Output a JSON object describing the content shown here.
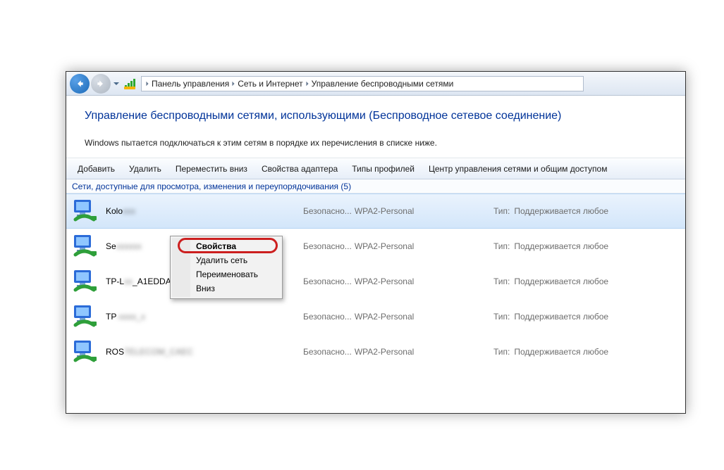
{
  "breadcrumb": {
    "item1": "Панель управления",
    "item2": "Сеть и Интернет",
    "item3": "Управление беспроводными сетями"
  },
  "header": {
    "title": "Управление беспроводными сетями, использующими (Беспроводное сетевое соединение)",
    "description": "Windows пытается подключаться к этим сетям в порядке их перечисления в списке ниже."
  },
  "toolbar": {
    "add": "Добавить",
    "remove": "Удалить",
    "move_down": "Переместить вниз",
    "adapter_props": "Свойства адаптера",
    "profile_types": "Типы профилей",
    "network_center": "Центр управления сетями и общим доступом"
  },
  "group_header": "Сети, доступные для просмотра, изменения и переупорядочивания (5)",
  "columns": {
    "security_label": "Безопасно...",
    "type_label": "Тип:"
  },
  "networks": [
    {
      "name_prefix": "Kolo",
      "name_blur": "xxx",
      "security": "WPA2-Personal",
      "type": "Поддерживается любое",
      "selected": true
    },
    {
      "name_prefix": "Se",
      "name_blur": "xxxxxx",
      "security": "WPA2-Personal",
      "type": "Поддерживается любое",
      "selected": false
    },
    {
      "name_prefix": "TP-L",
      "name_mid": "_A1EDDA",
      "name_blur": "xx",
      "security": "WPA2-Personal",
      "type": "Поддерживается любое",
      "selected": false
    },
    {
      "name_prefix": "TP",
      "name_blur": "-xxxx_x",
      "security": "WPA2-Personal",
      "type": "Поддерживается любое",
      "selected": false
    },
    {
      "name_prefix": "ROS",
      "name_blur": "TELECOM_CAEC",
      "security": "WPA2-Personal",
      "type": "Поддерживается любое",
      "selected": false
    }
  ],
  "context_menu": {
    "properties": "Свойства",
    "delete": "Удалить сеть",
    "rename": "Переименовать",
    "down": "Вниз"
  }
}
